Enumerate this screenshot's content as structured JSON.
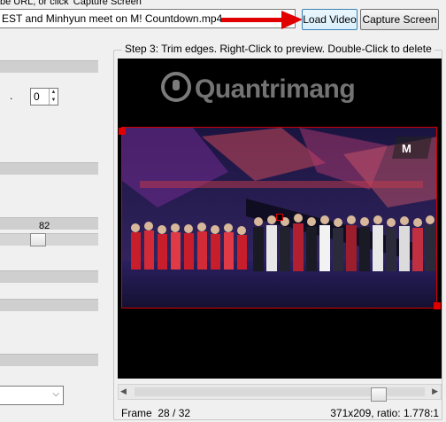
{
  "top": {
    "hint": "be URL, or click 'Capture Screen'",
    "url_value": "EST and Minhyun meet on M! Countdown.mp4",
    "load_label": "Load Video",
    "capture_label": "Capture Screen"
  },
  "left_panel": {
    "dot_label": ".",
    "spin_value": "0",
    "slider_value": "82",
    "slider_fraction": 0.37,
    "select_value": ""
  },
  "step3": {
    "title": "Step 3: Trim edges. Right-Click to preview. Double-Click to delete",
    "watermark": "Quantrimang",
    "frame_label": "Frame  28 / 32",
    "dims_label": "371x209, ratio: 1.778:1",
    "scroll_fraction": 0.86
  },
  "icons": {
    "arrow": "red-arrow-icon",
    "spin_arrows": "spin-arrows-icon",
    "chevron": "chevron-down-icon"
  },
  "colors": {
    "accent_red": "#e00000",
    "button_focus": "#3c7fb1"
  }
}
